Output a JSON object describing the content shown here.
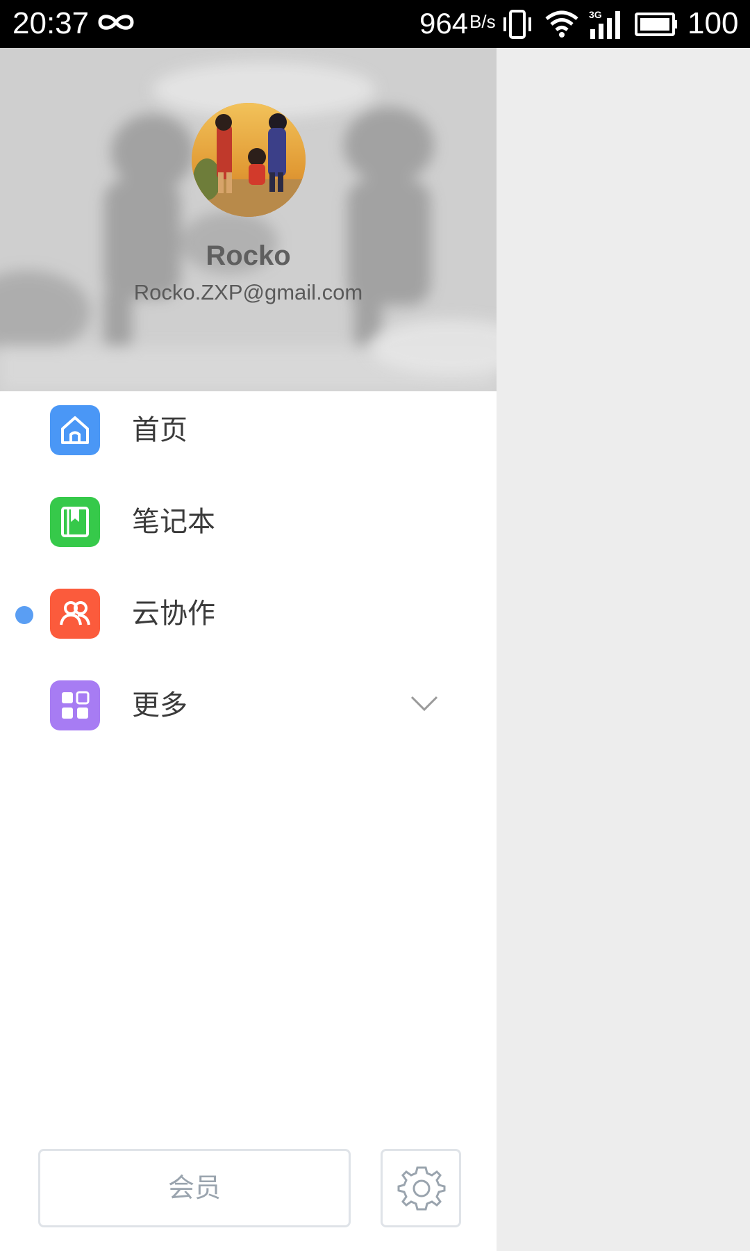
{
  "status_bar": {
    "time": "20:37",
    "speed": "964",
    "speed_unit": "B/s",
    "battery": "100",
    "icons": [
      "infinity-icon",
      "vibrate-icon",
      "wifi-icon",
      "signal-3g-icon",
      "battery-icon"
    ]
  },
  "profile": {
    "name": "Rocko",
    "email": "Rocko.ZXP@gmail.com"
  },
  "menu": {
    "items": [
      {
        "label": "首页",
        "icon": "home-icon",
        "color": "#4a97f6",
        "active": false
      },
      {
        "label": "笔记本",
        "icon": "notebook-icon",
        "color": "#36c94a",
        "active": false
      },
      {
        "label": "云协作",
        "icon": "collaboration-icon",
        "color": "#fb5b3c",
        "active": true
      },
      {
        "label": "更多",
        "icon": "more-grid-icon",
        "color": "#a77cf3",
        "active": false,
        "expandable": true
      }
    ]
  },
  "footer": {
    "vip_label": "会员",
    "settings_icon": "gear-icon"
  },
  "colors": {
    "active_dot": "#5a9ef3",
    "scrim": "#ededed"
  }
}
